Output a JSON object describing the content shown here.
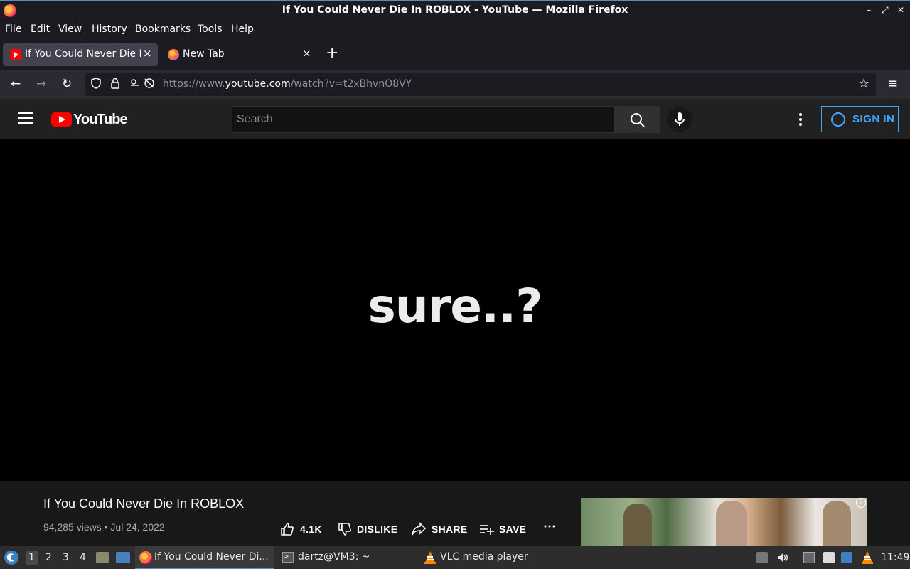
{
  "window": {
    "title": "If You Could Never Die In ROBLOX - YouTube — Mozilla Firefox",
    "minimize": "–",
    "maximize": "⤢",
    "close": "✕"
  },
  "menubar": {
    "items": [
      "File",
      "Edit",
      "View",
      "History",
      "Bookmarks",
      "Tools",
      "Help"
    ]
  },
  "tabs": [
    {
      "label": "If You Could Never Die In ROBLOX - YouTube",
      "close": "×",
      "active": true,
      "icon": "youtube-favicon"
    },
    {
      "label": "New Tab",
      "close": "×",
      "active": false,
      "icon": "firefox-favicon"
    }
  ],
  "newtab_button": "+",
  "navbar": {
    "back": "←",
    "forward": "→",
    "reload": "↻",
    "url_prefix": "https://www.",
    "url_host": "youtube.com",
    "url_path": "/watch?v=t2xBhvnO8VY",
    "bookmark_star": "☆",
    "menu": "≡"
  },
  "youtube": {
    "logo_text": "YouTube",
    "search_placeholder": "Search",
    "signin_label": "SIGN IN",
    "video_caption": "sure..?",
    "video_title": "If You Could Never Die In ROBLOX",
    "views": "94,285 views",
    "date": "Jul 24, 2022",
    "like_count": "4.1K",
    "dislike_label": "DISLIKE",
    "share_label": "SHARE",
    "save_label": "SAVE",
    "more_label": "⋯",
    "ad_info": "i"
  },
  "taskbar": {
    "workspaces": [
      "1",
      "2",
      "3",
      "4"
    ],
    "tasks": [
      {
        "label": "If You Could Never Di...",
        "icon": "firefox-icon"
      },
      {
        "label": "dartz@VM3: ~",
        "icon": "terminal-icon"
      },
      {
        "label": "VLC media player",
        "icon": "vlc-icon"
      }
    ],
    "clock": "11:49"
  },
  "colors": {
    "accent_blue": "#3ea6ff",
    "youtube_red": "#ff0000",
    "firefox_dark": "#1c1b22"
  }
}
